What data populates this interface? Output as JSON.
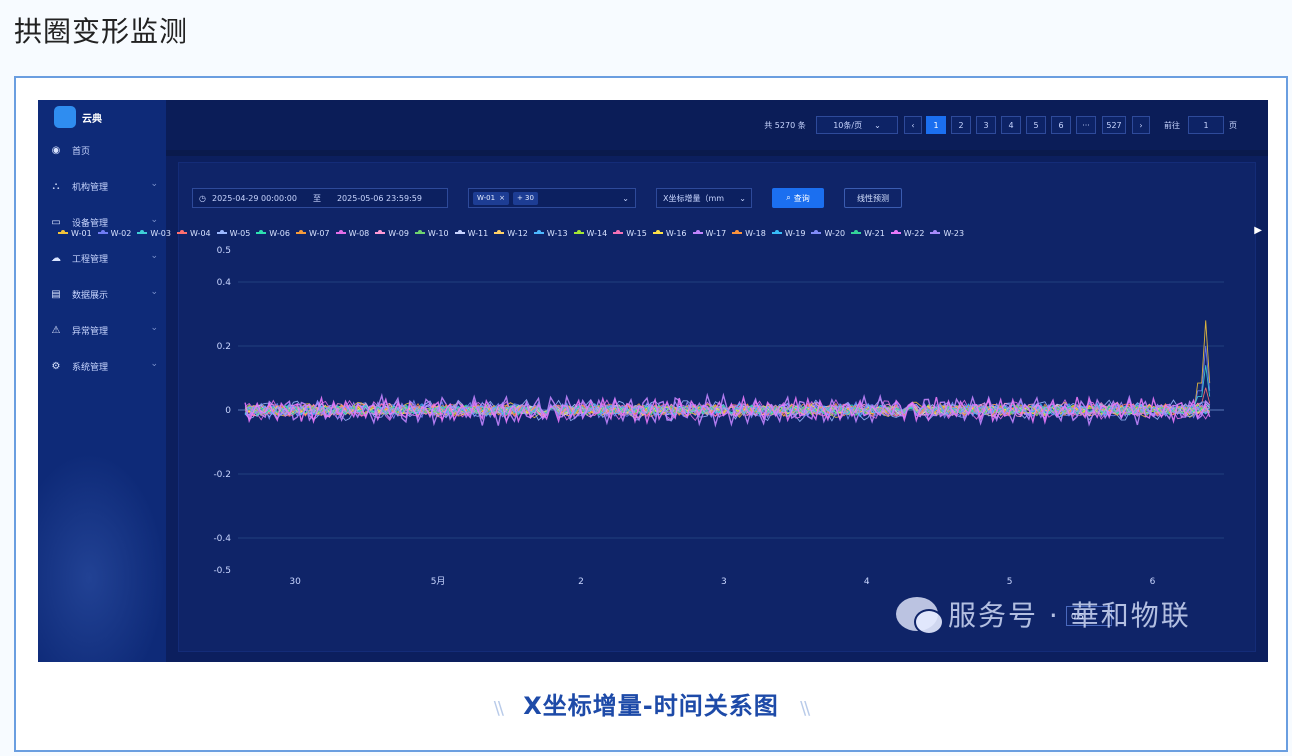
{
  "article_title": "拱圈变形监测",
  "caption": "X坐标增量-时间关系图",
  "caption_decor_left": "\\\\",
  "caption_decor_right": "\\\\",
  "app": {
    "logo_text": "云典",
    "menu": [
      {
        "label": "首页",
        "icon": "dashboard-icon",
        "has_children": false
      },
      {
        "label": "机构管理",
        "icon": "org-tree-icon",
        "has_children": true
      },
      {
        "label": "设备管理",
        "icon": "monitor-icon",
        "has_children": true
      },
      {
        "label": "工程管理",
        "icon": "cloud-icon",
        "has_children": true
      },
      {
        "label": "数据展示",
        "icon": "data-screen-icon",
        "has_children": true
      },
      {
        "label": "异常管理",
        "icon": "warning-icon",
        "has_children": true
      },
      {
        "label": "系统管理",
        "icon": "gear-icon",
        "has_children": true
      }
    ],
    "menu_chevron": "⌄"
  },
  "pagination": {
    "total": "共 5270 条",
    "page_size": "10条/页",
    "prev": "‹",
    "pages": [
      "1",
      "2",
      "3",
      "4",
      "5",
      "6"
    ],
    "ellipsis": "···",
    "last": "527",
    "next": "›",
    "goto_label": "前往",
    "goto_value": "1",
    "goto_suffix": "页",
    "active_page": "1"
  },
  "filters": {
    "start": "2025-04-29 00:00:00",
    "sep": "至",
    "end": "2025-05-06 23:59:59",
    "tag_selected": "W-01",
    "tag_more": "+ 30",
    "metric": "X坐标增量（mm",
    "query_label": "查询",
    "predict_label": "线性预测"
  },
  "chart_data": {
    "type": "line",
    "series_names": [
      "W-01",
      "W-02",
      "W-03",
      "W-04",
      "W-05",
      "W-06",
      "W-07",
      "W-08",
      "W-09",
      "W-10",
      "W-11",
      "W-12",
      "W-13",
      "W-14",
      "W-15",
      "W-16",
      "W-17",
      "W-18",
      "W-19",
      "W-20",
      "W-21",
      "W-22",
      "W-23"
    ],
    "colors": [
      "#f3c43a",
      "#6f7cf5",
      "#3fd0d8",
      "#ff6f6f",
      "#9bb7ff",
      "#2de0b0",
      "#f59a3a",
      "#e36ee8",
      "#ff9ad5",
      "#6ed36e",
      "#c7d2ff",
      "#ffd166",
      "#4db8ff",
      "#a3e635",
      "#f472b6",
      "#fde047",
      "#c084fc",
      "#fb923c",
      "#38bdf8",
      "#818cf8",
      "#34d399",
      "#e879f9",
      "#a78bfa"
    ],
    "x_ticks": [
      "30",
      "5月",
      "2",
      "3",
      "4",
      "5",
      "6"
    ],
    "y_ticks": [
      "0.5",
      "0.4",
      "0.2",
      "0",
      "-0.2",
      "-0.4",
      "-0.5"
    ],
    "ylim": [
      -0.5,
      0.5
    ],
    "y_tick_values": [
      0.5,
      0.4,
      0.2,
      0,
      -0.2,
      -0.4,
      -0.5
    ],
    "x_range_days": [
      29.6,
      36.5
    ],
    "x_tick_positions": [
      30,
      31,
      32,
      33,
      34,
      35,
      36
    ],
    "grid": "horizontal",
    "legend_position": "top",
    "noise_amplitude": 0.03,
    "spike": {
      "x": 36.4,
      "values": [
        0.28,
        0.2,
        0.14,
        0.07
      ]
    }
  },
  "zoom_input": "0.5",
  "watermark": "服务号 · 華和物联",
  "legend_next": "▶"
}
